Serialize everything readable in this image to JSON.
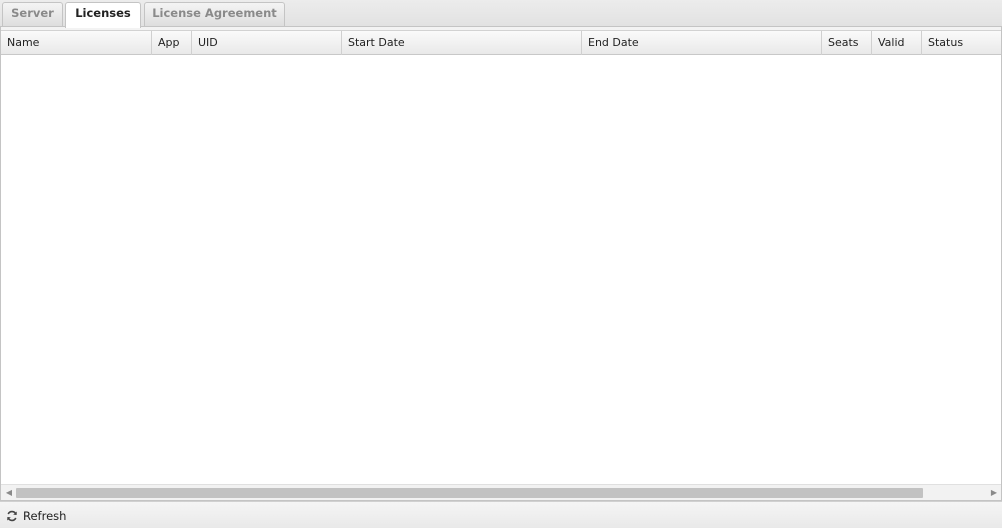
{
  "tabs": [
    {
      "label": "Server",
      "active": false
    },
    {
      "label": "Licenses",
      "active": true
    },
    {
      "label": "License Agreement",
      "active": false
    }
  ],
  "table": {
    "columns": [
      "Name",
      "App",
      "UID",
      "Start Date",
      "End Date",
      "Seats",
      "Valid",
      "Status"
    ],
    "rows": []
  },
  "footer": {
    "refresh_label": "Refresh",
    "refresh_icon": "refresh-icon"
  },
  "colors": {
    "tab_active_bg": "#ffffff",
    "tab_inactive_text": "#8a8a8a",
    "scroll_thumb": "#c2c2c2"
  }
}
